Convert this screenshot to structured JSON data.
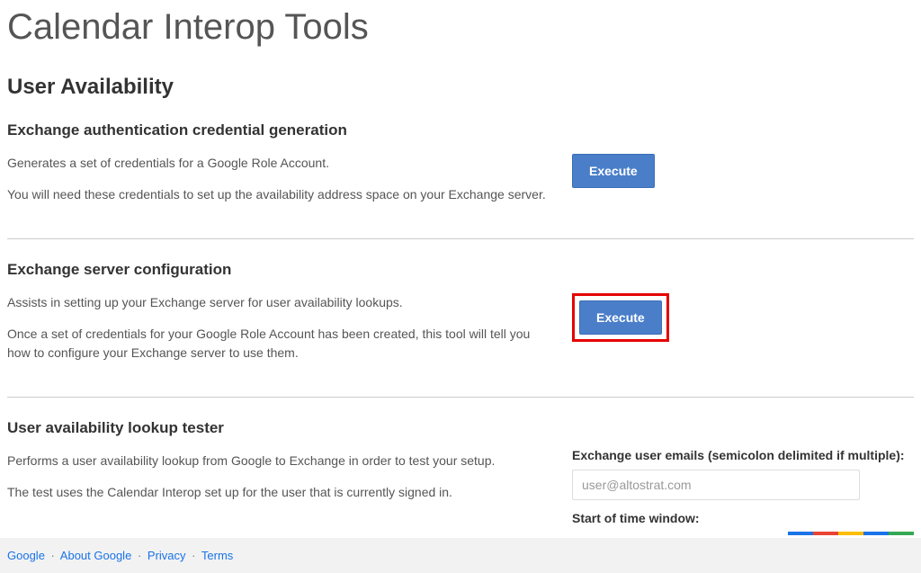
{
  "page": {
    "title": "Calendar Interop Tools",
    "section_title": "User Availability"
  },
  "sections": {
    "credgen": {
      "title": "Exchange authentication credential generation",
      "desc1": "Generates a set of credentials for a Google Role Account.",
      "desc2": "You will need these credentials to set up the availability address space on your Exchange server.",
      "button": "Execute"
    },
    "serverconfig": {
      "title": "Exchange server configuration",
      "desc1": "Assists in setting up your Exchange server for user availability lookups.",
      "desc2": "Once a set of credentials for your Google Role Account has been created, this tool will tell you how to configure your Exchange server to use them.",
      "button": "Execute"
    },
    "lookuptester": {
      "title": "User availability lookup tester",
      "desc1": "Performs a user availability lookup from Google to Exchange in order to test your setup.",
      "desc2": "The test uses the Calendar Interop set up for the user that is currently signed in.",
      "form": {
        "emails_label": "Exchange user emails (semicolon delimited if multiple):",
        "emails_value": "user@altostrat.com",
        "start_label": "Start of time window:"
      }
    }
  },
  "footer": {
    "google": "Google",
    "about": "About Google",
    "privacy": "Privacy",
    "terms": "Terms"
  }
}
